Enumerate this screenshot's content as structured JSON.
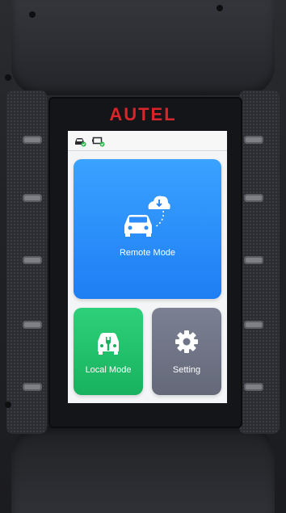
{
  "brand": {
    "logo_text": "AUTEL",
    "logo_color": "#d7262b"
  },
  "status_bar": {
    "icons": [
      "car-connected-icon",
      "vci-connected-icon"
    ],
    "status_color": "#2db24a"
  },
  "tiles": {
    "remote": {
      "label": "Remote Mode",
      "icon": "car-cloud-icon",
      "color": "#1e7ef4"
    },
    "local": {
      "label": "Local Mode",
      "icon": "car-wrench-icon",
      "color": "#18b25e"
    },
    "setting": {
      "label": "Setting",
      "icon": "gear-icon",
      "color": "#646979"
    }
  }
}
